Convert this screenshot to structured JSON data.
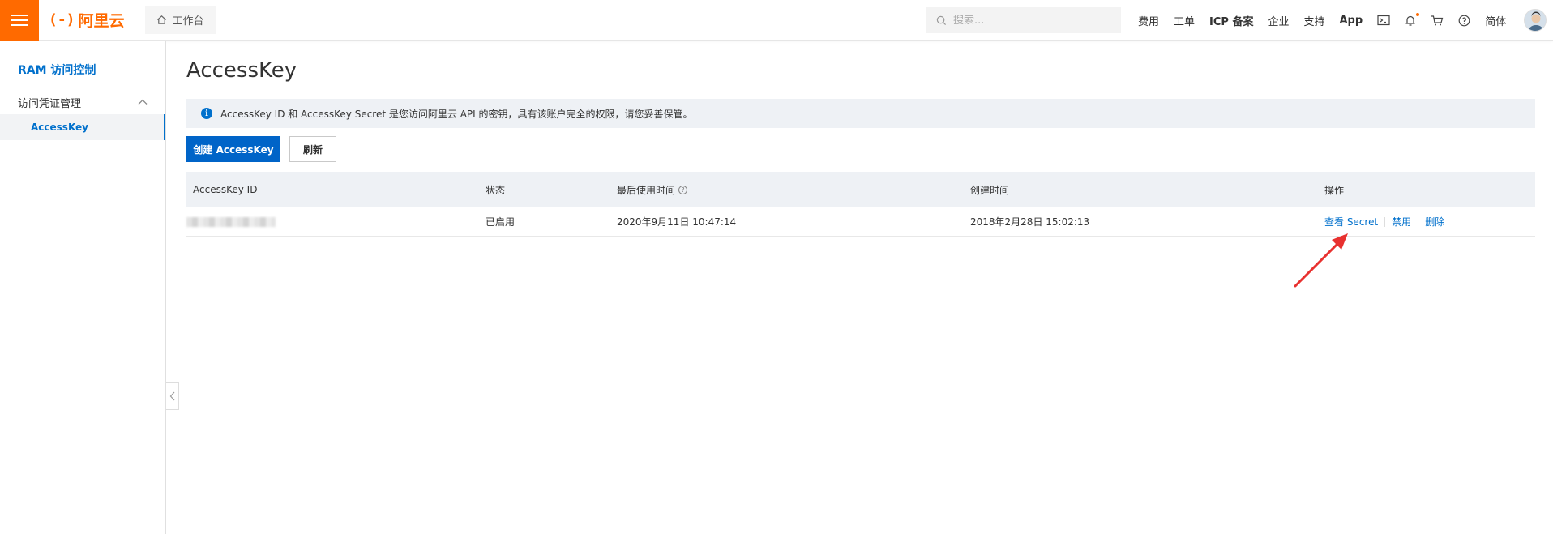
{
  "topbar": {
    "logo_mark": "(-)",
    "logo_text": "阿里云",
    "workbench_label": "工作台",
    "search_placeholder": "搜索...",
    "links": [
      "费用",
      "工单",
      "ICP 备案",
      "企业",
      "支持",
      "App"
    ],
    "language": "简体",
    "icons": [
      "terminal-icon",
      "bell-icon",
      "cart-icon",
      "help-icon"
    ],
    "accent_color": "#ff6a00"
  },
  "sidebar": {
    "title": "RAM 访问控制",
    "group_label": "访问凭证管理",
    "active_item": "AccessKey",
    "accent_color": "#0070cc"
  },
  "main": {
    "title": "AccessKey",
    "notice": "AccessKey ID 和 AccessKey Secret 是您访问阿里云 API 的密钥，具有该账户完全的权限，请您妥善保管。",
    "create_button": "创建 AccessKey",
    "refresh_button": "刷新",
    "table": {
      "headers": [
        "AccessKey ID",
        "状态",
        "最后使用时间",
        "创建时间",
        "操作"
      ],
      "rows": [
        {
          "status": "已启用",
          "last_used": "2020年9月11日 10:47:14",
          "created": "2018年2月28日 15:02:13",
          "actions": [
            "查看 Secret",
            "禁用",
            "删除"
          ]
        }
      ]
    }
  }
}
